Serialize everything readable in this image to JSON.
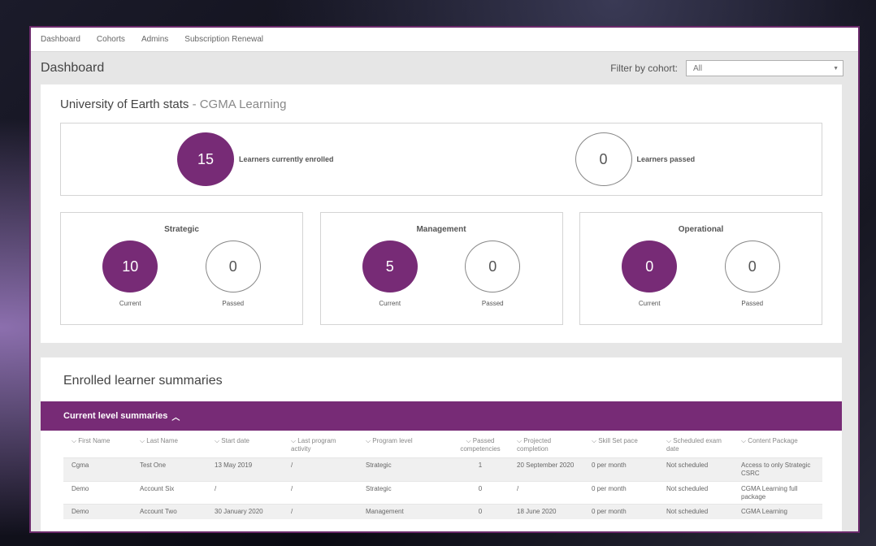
{
  "nav": [
    "Dashboard",
    "Cohorts",
    "Admins",
    "Subscription Renewal"
  ],
  "header": {
    "title": "Dashboard",
    "filter_label": "Filter by cohort:",
    "filter_value": "All"
  },
  "stats": {
    "title": "University of Earth stats",
    "subtitle": "- CGMA Learning",
    "enrolled_value": "15",
    "enrolled_label": "Learners currently enrolled",
    "passed_value": "0",
    "passed_label": "Learners passed"
  },
  "levels": [
    {
      "title": "Strategic",
      "current": "10",
      "passed": "0",
      "current_label": "Current",
      "passed_label": "Passed"
    },
    {
      "title": "Management",
      "current": "5",
      "passed": "0",
      "current_label": "Current",
      "passed_label": "Passed"
    },
    {
      "title": "Operational",
      "current": "0",
      "passed": "0",
      "current_label": "Current",
      "passed_label": "Passed"
    }
  ],
  "summaries": {
    "title": "Enrolled learner summaries",
    "section_label": "Current level summaries",
    "columns": [
      "First Name",
      "Last Name",
      "Start date",
      "Last program activity",
      "Program level",
      "Passed competencies",
      "Projected completion",
      "Skill Set pace",
      "Scheduled exam date",
      "Content Package"
    ],
    "rows": [
      [
        "Cgma",
        "Test One",
        "13 May 2019",
        "/",
        "Strategic",
        "1",
        "20 September 2020",
        "0 per month",
        "Not scheduled",
        "Access to only Strategic CSRC"
      ],
      [
        "Demo",
        "Account Six",
        "/",
        "/",
        "Strategic",
        "0",
        "/",
        "0 per month",
        "Not scheduled",
        "CGMA Learning full package"
      ],
      [
        "Demo",
        "Account Two",
        "30 January 2020",
        "/",
        "Management",
        "0",
        "18 June 2020",
        "0 per month",
        "Not scheduled",
        "CGMA Learning"
      ]
    ]
  },
  "colors": {
    "accent": "#772b76"
  }
}
